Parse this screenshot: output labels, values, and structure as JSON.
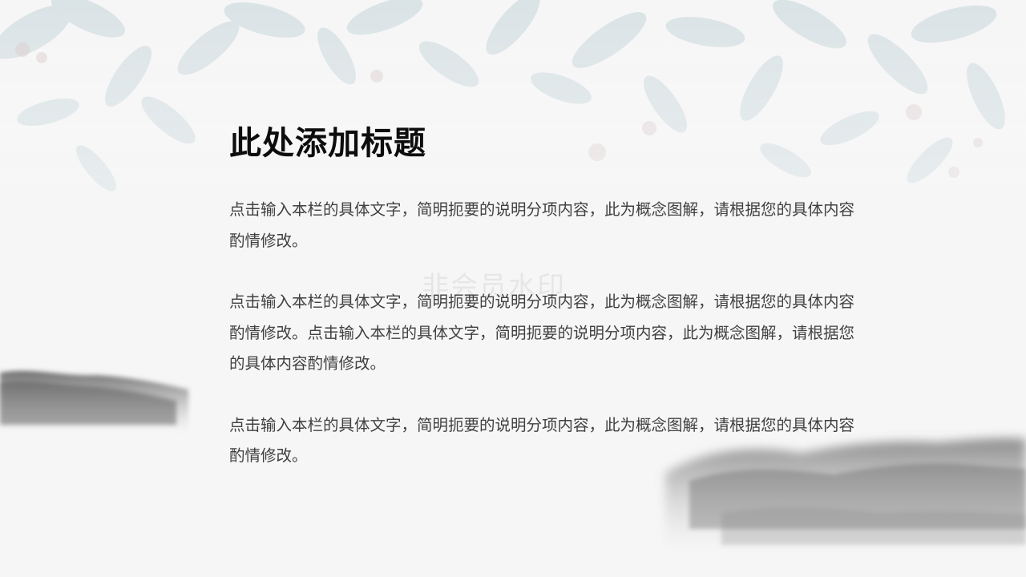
{
  "slide": {
    "title": "此处添加标题",
    "paragraphs": [
      "点击输入本栏的具体文字，简明扼要的说明分项内容，此为概念图解，请根据您的具体内容酌情修改。",
      "点击输入本栏的具体文字，简明扼要的说明分项内容，此为概念图解，请根据您的具体内容酌情修改。点击输入本栏的具体文字，简明扼要的说明分项内容，此为概念图解，请根据您的具体内容酌情修改。",
      "点击输入本栏的具体文字，简明扼要的说明分项内容，此为概念图解，请根据您的具体内容酌情修改。"
    ],
    "watermark": "非会员水印"
  },
  "colors": {
    "background": "#f6f6f6",
    "title": "#0d0d0d",
    "body_text": "#404040",
    "ink_mountain": "#6e6e6e",
    "leaf": "#c4d3d9"
  }
}
